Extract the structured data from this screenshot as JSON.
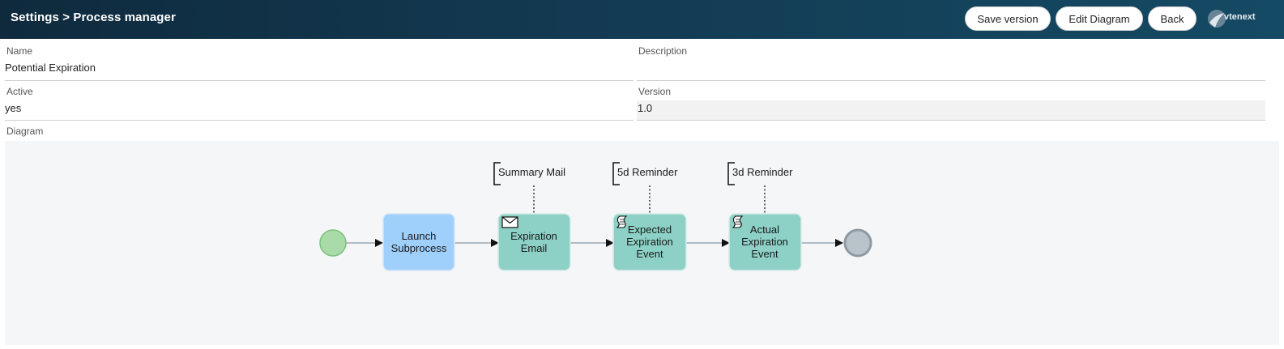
{
  "header": {
    "breadcrumb": "Settings > Process manager",
    "buttons": {
      "save_version": "Save version",
      "edit_diagram": "Edit Diagram",
      "back": "Back"
    },
    "logo_text": "vtenext"
  },
  "form": {
    "name": {
      "label": "Name",
      "value": "Potential Expiration"
    },
    "description": {
      "label": "Description",
      "value": ""
    },
    "active": {
      "label": "Active",
      "value": "yes"
    },
    "version": {
      "label": "Version",
      "value": "1.0"
    },
    "diagram_label": "Diagram"
  },
  "diagram": {
    "tasks": [
      {
        "id": "launch",
        "lines": [
          "Launch",
          "Subprocess"
        ],
        "icon": "none",
        "color": "#9fcffb"
      },
      {
        "id": "email",
        "lines": [
          "Expiration",
          "Email"
        ],
        "icon": "envelope-icon",
        "color": "#8dd1c6",
        "annotation": "Summary Mail"
      },
      {
        "id": "expected",
        "lines": [
          "Expected",
          "Expiration",
          "Event"
        ],
        "icon": "script-icon",
        "color": "#8dd1c6",
        "annotation": "5d Reminder"
      },
      {
        "id": "actual",
        "lines": [
          "Actual",
          "Expiration",
          "Event"
        ],
        "icon": "script-icon",
        "color": "#8dd1c6",
        "annotation": "3d Reminder"
      }
    ],
    "start_color": "#a8dba8",
    "end_color": "#b9c3ca"
  }
}
